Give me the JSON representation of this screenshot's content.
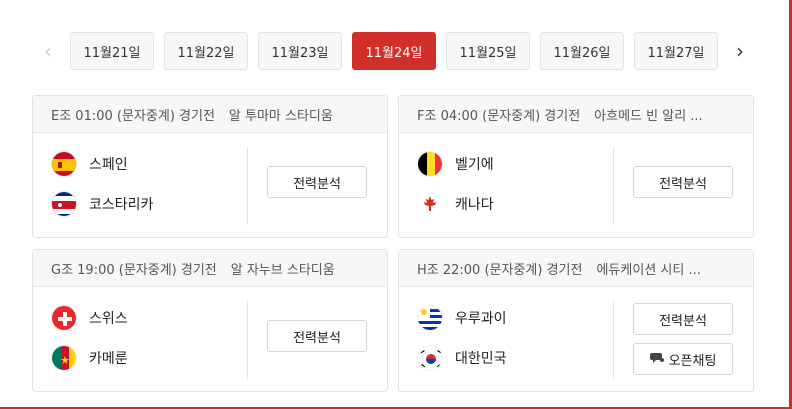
{
  "nav": {
    "prev_icon": "‹",
    "next_icon": "›"
  },
  "dates": [
    "11월21일",
    "11월22일",
    "11월23일",
    "11월24일",
    "11월25일",
    "11월26일",
    "11월27일"
  ],
  "active_date_index": 3,
  "colors": {
    "accent": "#d32f2a"
  },
  "matches": [
    {
      "group": "E조 01:00 (문자중계) 경기전",
      "venue": "알 투마마 스타디움",
      "team1": {
        "name": "스페인",
        "flag": "spain-flag"
      },
      "team2": {
        "name": "코스타리카",
        "flag": "costa-rica-flag"
      },
      "analysis_label": "전력분석"
    },
    {
      "group": "F조 04:00 (문자중계) 경기전",
      "venue": "아흐메드 빈 알리 ...",
      "team1": {
        "name": "벨기에",
        "flag": "belgium-flag"
      },
      "team2": {
        "name": "캐나다",
        "flag": "canada-flag"
      },
      "analysis_label": "전력분석"
    },
    {
      "group": "G조 19:00 (문자중계) 경기전",
      "venue": "알 자누브 스타디움",
      "team1": {
        "name": "스위스",
        "flag": "switzerland-flag"
      },
      "team2": {
        "name": "카메룬",
        "flag": "cameroon-flag"
      },
      "analysis_label": "전력분석"
    },
    {
      "group": "H조 22:00 (문자중계) 경기전",
      "venue": "에듀케이션 시티 ...",
      "team1": {
        "name": "우루과이",
        "flag": "uruguay-flag"
      },
      "team2": {
        "name": "대한민국",
        "flag": "south-korea-flag"
      },
      "analysis_label": "전력분석",
      "chat_label": "오픈채팅"
    }
  ]
}
